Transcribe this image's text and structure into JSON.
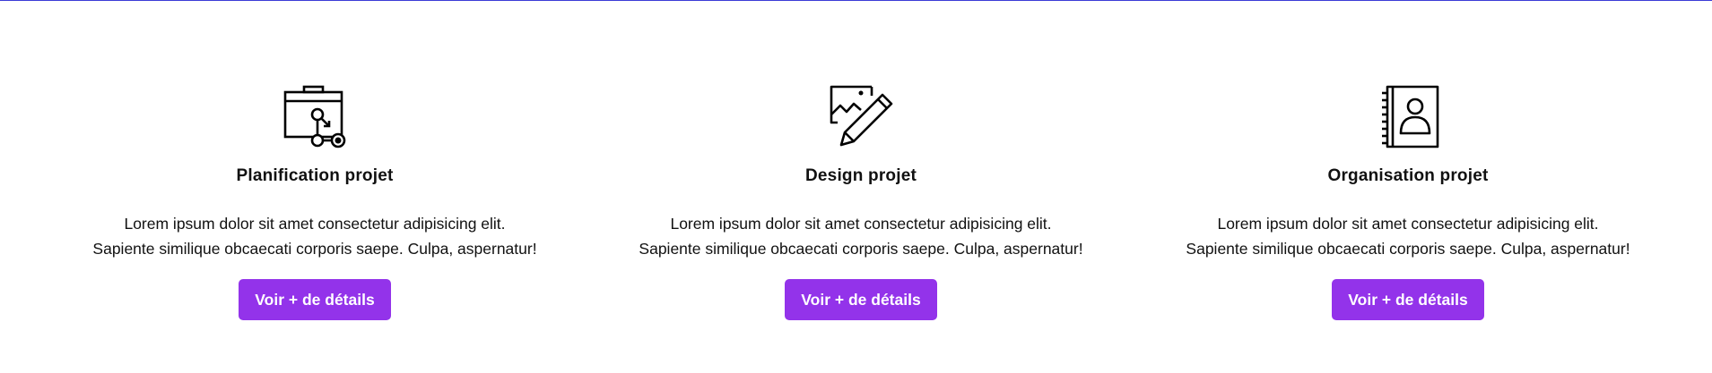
{
  "accent": "#9333ea",
  "cards": [
    {
      "icon": "project-planning-icon",
      "title": "Planification projet",
      "line1": "Lorem ipsum dolor sit amet consectetur adipisicing elit.",
      "line2": "Sapiente similique obcaecati corporis saepe. Culpa, aspernatur!",
      "button": "Voir + de détails"
    },
    {
      "icon": "image-pencil-icon",
      "title": "Design projet",
      "line1": "Lorem ipsum dolor sit amet consectetur adipisicing elit.",
      "line2": "Sapiente similique obcaecati corporis saepe. Culpa, aspernatur!",
      "button": "Voir + de détails"
    },
    {
      "icon": "contact-book-icon",
      "title": "Organisation projet",
      "line1": "Lorem ipsum dolor sit amet consectetur adipisicing elit.",
      "line2": "Sapiente similique obcaecati corporis saepe. Culpa, aspernatur!",
      "button": "Voir + de détails"
    }
  ]
}
